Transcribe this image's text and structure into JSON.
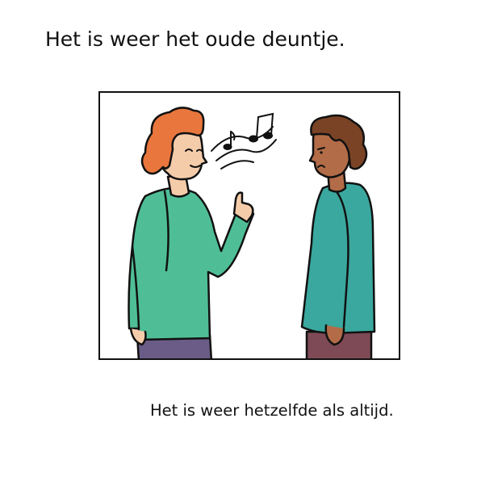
{
  "captions": {
    "top": "Het is weer het oude deuntje.",
    "bottom": "Het is weer hetzelfde als altijd."
  },
  "illustration": {
    "characters": [
      "person-humming",
      "person-annoyed"
    ],
    "icons": [
      "music-notes-icon"
    ],
    "colors": {
      "left_hair": "#E8763D",
      "left_shirt": "#4FBE96",
      "left_pants": "#6A5C86",
      "skin_light": "#F5CCAA",
      "right_hair": "#7A4326",
      "right_shirt": "#3AA89E",
      "right_pants": "#7E4A56",
      "skin_dark": "#B26C47",
      "outline": "#111111"
    }
  }
}
